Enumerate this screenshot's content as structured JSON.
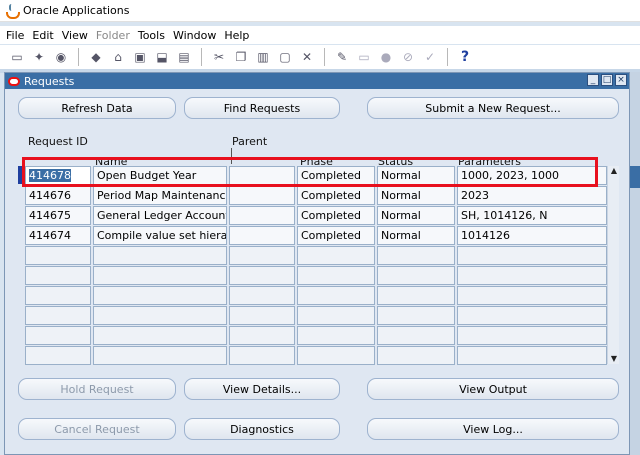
{
  "app": {
    "title": "Oracle Applications"
  },
  "menu": [
    "File",
    "Edit",
    "View",
    "Folder",
    "Tools",
    "Window",
    "Help"
  ],
  "toolbar": {
    "icons": [
      "open-icon",
      "flashlight-icon",
      "navigator-icon",
      "save-icon",
      "next-step-icon",
      "print-icon",
      "clear-icon",
      "folder-icon",
      "cut-icon",
      "copy-icon",
      "paste-icon",
      "clear-field-icon",
      "edit-icon",
      "attachments-icon",
      "zoom-icon",
      "translations-icon",
      "attach-icon",
      "folder-tools-icon",
      "help-icon"
    ],
    "help_glyph": "?"
  },
  "window": {
    "title": "Requests"
  },
  "buttons": {
    "refresh": "Refresh Data",
    "find": "Find Requests",
    "submit": "Submit a New Request...",
    "hold": "Hold Request",
    "view_details": "View Details...",
    "view_output": "View Output",
    "cancel": "Cancel Request",
    "diagnostics": "Diagnostics",
    "view_log": "View Log..."
  },
  "columns": {
    "request_id": "Request ID",
    "parent": "Parent",
    "name": "Name",
    "phase": "Phase",
    "status": "Status",
    "parameters": "Parameters"
  },
  "rows": [
    {
      "id": "414678",
      "name": "Open Budget Year",
      "parent": "",
      "phase": "Completed",
      "status": "Normal",
      "params": "1000, 2023, 1000"
    },
    {
      "id": "414676",
      "name": "Period Map Maintenance P",
      "parent": "",
      "phase": "Completed",
      "status": "Normal",
      "params": "2023"
    },
    {
      "id": "414675",
      "name": "General Ledger Accounting",
      "parent": "",
      "phase": "Completed",
      "status": "Normal",
      "params": "SH, 1014126, N"
    },
    {
      "id": "414674",
      "name": "Compile value set hierarchi",
      "parent": "",
      "phase": "Completed",
      "status": "Normal",
      "params": "1014126"
    }
  ],
  "empty_rows": 6,
  "colors": {
    "highlight": "#e8101e",
    "title_bar": "#3a6ea5"
  }
}
